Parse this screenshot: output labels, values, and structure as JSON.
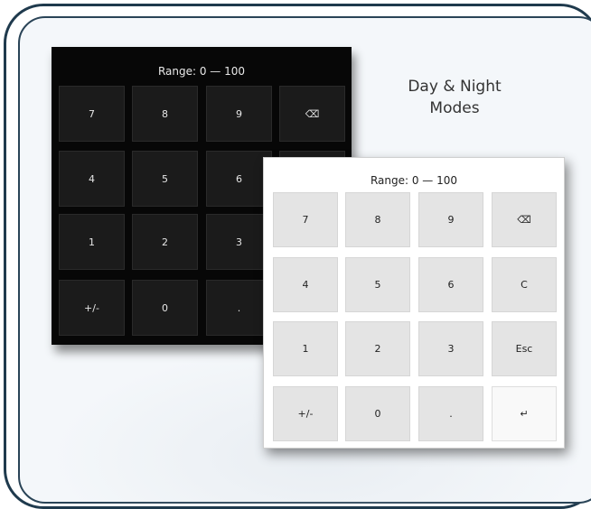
{
  "caption": {
    "line1": "Day & Night",
    "line2": "Modes"
  },
  "dark_pad": {
    "range_label": "Range: 0 — 100",
    "rows": [
      [
        "7",
        "8",
        "9",
        "⌫"
      ],
      [
        "4",
        "5",
        "6",
        ""
      ],
      [
        "1",
        "2",
        "3",
        ""
      ],
      [
        "+/-",
        "0",
        ".",
        ""
      ]
    ]
  },
  "light_pad": {
    "range_label": "Range: 0 — 100",
    "rows": [
      [
        "7",
        "8",
        "9",
        "⌫"
      ],
      [
        "4",
        "5",
        "6",
        "C"
      ],
      [
        "1",
        "2",
        "3",
        "Esc"
      ],
      [
        "+/-",
        "0",
        ".",
        "↵"
      ]
    ]
  },
  "colors": {
    "frame": "#1f3a4d",
    "dark_bg": "#070707",
    "dark_key": "#1b1b1b",
    "light_key": "#e4e4e4"
  }
}
